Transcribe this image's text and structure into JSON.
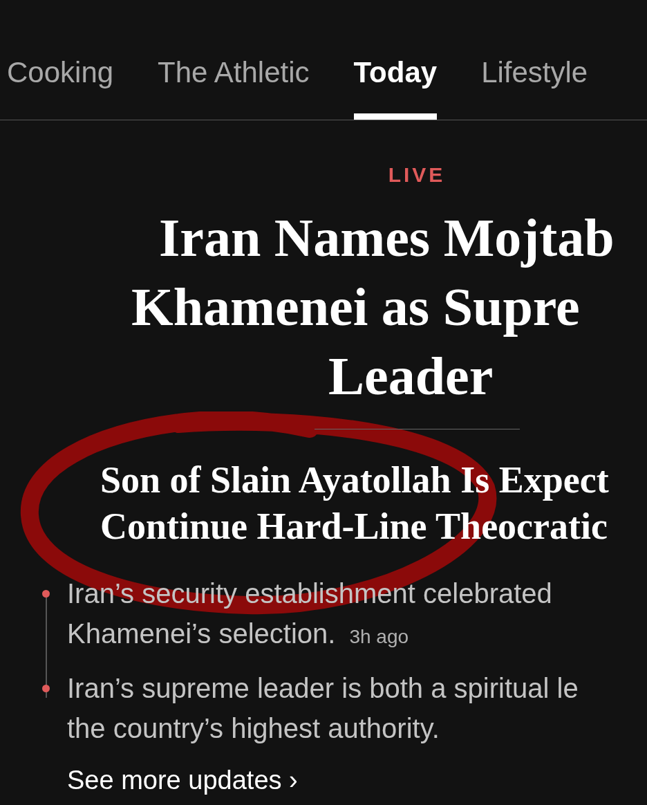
{
  "tabs": [
    {
      "label": "Cooking",
      "selected": false
    },
    {
      "label": "The Athletic",
      "selected": false
    },
    {
      "label": "Today",
      "selected": true
    },
    {
      "label": "Lifestyle",
      "selected": false
    }
  ],
  "story": {
    "badge": "LIVE",
    "headline_lines": [
      "Iran Names Mojtab",
      "Khamenei as Supre",
      "Leader"
    ],
    "subheadline_lines": [
      "Son of Slain Ayatollah Is Expect",
      "Continue Hard-Line Theocratic"
    ],
    "updates": [
      {
        "lines": [
          "Iran’s security establishment celebrated",
          "Khamenei’s selection."
        ],
        "time": "3h ago"
      },
      {
        "lines": [
          "Iran’s supreme leader is both a spiritual le",
          "the country’s highest authority."
        ]
      }
    ],
    "more_link": "See more updates ›"
  }
}
